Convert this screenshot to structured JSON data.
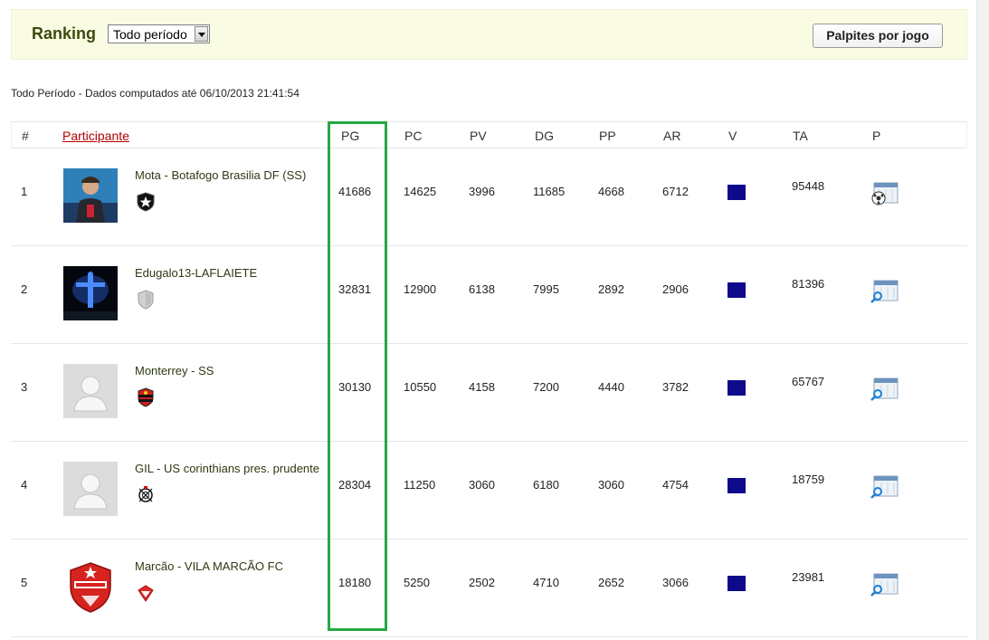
{
  "header": {
    "title": "Ranking",
    "period_select": "Todo período",
    "palpites_button": "Palpites por jogo"
  },
  "period_info": "Todo Período - Dados computados até 06/10/2013 21:41:54",
  "columns": [
    "#",
    "Participante",
    "PG",
    "PC",
    "PV",
    "DG",
    "PP",
    "AR",
    "V",
    "TA",
    "P"
  ],
  "rows": [
    {
      "pos": "1",
      "name": "Mota - Botafogo Brasilia DF (SS)",
      "avatar": "photo-person",
      "badge": "botafogo-star-badge",
      "pg": "41686",
      "pc": "14625",
      "pv": "3996",
      "dg": "11685",
      "pp": "4668",
      "ar": "6712",
      "ta": "95448",
      "p_icon": "soccer-calendar-icon"
    },
    {
      "pos": "2",
      "name": "Edugalo13-LAFLAIETE",
      "avatar": "photo-christ-statue",
      "badge": "grey-shield-badge",
      "pg": "32831",
      "pc": "12900",
      "pv": "6138",
      "dg": "7995",
      "pp": "2892",
      "ar": "2906",
      "ta": "81396",
      "p_icon": "search-calendar-icon"
    },
    {
      "pos": "3",
      "name": "Monterrey - SS",
      "avatar": "default-user-icon",
      "badge": "vitoria-badge",
      "pg": "30130",
      "pc": "10550",
      "pv": "4158",
      "dg": "7200",
      "pp": "4440",
      "ar": "3782",
      "ta": "65767",
      "p_icon": "search-calendar-icon"
    },
    {
      "pos": "4",
      "name": "GIL - US corinthians pres. prudente",
      "avatar": "default-user-icon",
      "badge": "corinthians-badge",
      "pg": "28304",
      "pc": "11250",
      "pv": "3060",
      "dg": "6180",
      "pp": "3060",
      "ar": "4754",
      "ta": "18759",
      "p_icon": "search-calendar-icon"
    },
    {
      "pos": "5",
      "name": "Marcão - VILA MARCÃO FC",
      "avatar": "vila-marcao-crest",
      "badge": "red-diamond-badge",
      "pg": "18180",
      "pc": "5250",
      "pv": "2502",
      "dg": "4710",
      "pp": "2652",
      "ar": "3066",
      "ta": "23981",
      "p_icon": "search-calendar-icon"
    }
  ],
  "colors": {
    "topbar_bg": "#fafbe3",
    "title": "#3b4a0e",
    "sort_link": "#b30000",
    "v_box": "#0f0a8c",
    "highlight": "#27a844"
  }
}
